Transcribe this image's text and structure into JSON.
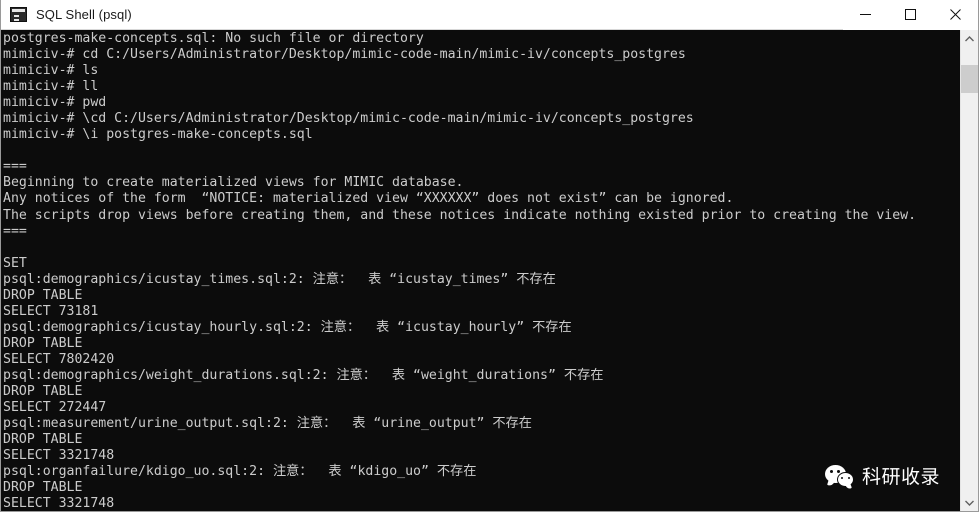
{
  "window": {
    "title": "SQL Shell (psql)",
    "icon": "console-icon",
    "background_color": "#0c0c0c",
    "titlebar_color": "#ffffff",
    "text_color": "#cccccc"
  },
  "window_controls": [
    {
      "name": "minimize-button",
      "glyph": "minimize"
    },
    {
      "name": "maximize-button",
      "glyph": "maximize"
    },
    {
      "name": "close-button",
      "glyph": "close"
    }
  ],
  "scrollbar": {
    "up_arrow": "scroll-up-arrow",
    "down_arrow": "scroll-down-arrow",
    "thumb_top_pct": 4,
    "thumb_height_pct": 6.4,
    "track_color": "#f0f0f0",
    "thumb_color": "#cdcdcd"
  },
  "watermark": {
    "logo": "wechat-logo",
    "text": "科研收录"
  },
  "terminal": {
    "prompt": "mimiciv-#",
    "lines": [
      "postgres-make-concepts.sql: No such file or directory",
      "mimiciv-# cd C:/Users/Administrator/Desktop/mimic-code-main/mimic-iv/concepts_postgres",
      "mimiciv-# ls",
      "mimiciv-# ll",
      "mimiciv-# pwd",
      "mimiciv-# \\cd C:/Users/Administrator/Desktop/mimic-code-main/mimic-iv/concepts_postgres",
      "mimiciv-# \\i postgres-make-concepts.sql",
      "",
      "===",
      "Beginning to create materialized views for MIMIC database.",
      "Any notices of the form  “NOTICE: materialized view “XXXXXX” does not exist” can be ignored.",
      "The scripts drop views before creating them, and these notices indicate nothing existed prior to creating the view.",
      "===",
      "",
      "SET",
      "psql:demographics/icustay_times.sql:2: 注意：  表 “icustay_times” 不存在",
      "DROP TABLE",
      "SELECT 73181",
      "psql:demographics/icustay_hourly.sql:2: 注意：  表 “icustay_hourly” 不存在",
      "DROP TABLE",
      "SELECT 7802420",
      "psql:demographics/weight_durations.sql:2: 注意：  表 “weight_durations” 不存在",
      "DROP TABLE",
      "SELECT 272447",
      "psql:measurement/urine_output.sql:2: 注意：  表 “urine_output” 不存在",
      "DROP TABLE",
      "SELECT 3321748",
      "psql:organfailure/kdigo_uo.sql:2: 注意：  表 “kdigo_uo” 不存在",
      "DROP TABLE",
      "SELECT 3321748"
    ]
  }
}
